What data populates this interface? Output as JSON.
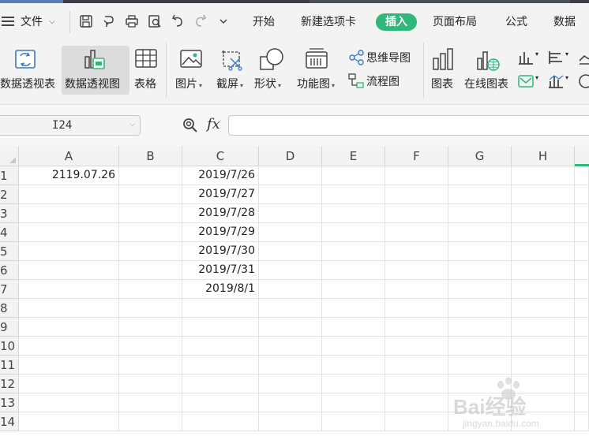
{
  "menubar": {
    "file_label": "文件",
    "tabs": [
      "开始",
      "新建选项卡",
      "插入",
      "页面布局",
      "公式",
      "数据"
    ],
    "active_tab": "插入",
    "accent": "#2fb87a"
  },
  "ribbon": {
    "pivot_table": "数据透视表",
    "pivot_chart": "数据透视图",
    "table": "表格",
    "picture": "图片",
    "screenshot": "截屏",
    "shapes": "形状",
    "function_chart": "功能图",
    "mind_map": "思维导图",
    "flowchart": "流程图",
    "chart": "图表",
    "online_chart": "在线图表"
  },
  "formula_bar": {
    "name_box": "I24",
    "fx": "fx",
    "formula": ""
  },
  "sheet": {
    "columns": [
      "A",
      "B",
      "C",
      "D",
      "E",
      "F",
      "G",
      "H"
    ],
    "rows": [
      "1",
      "2",
      "3",
      "4",
      "5",
      "6",
      "7",
      "8",
      "9",
      "10",
      "11",
      "12",
      "13",
      "14"
    ],
    "cells": {
      "A1": "2119.07.26",
      "C1": "2019/7/26",
      "C2": "2019/7/27",
      "C3": "2019/7/28",
      "C4": "2019/7/29",
      "C5": "2019/7/30",
      "C6": "2019/7/31",
      "C7": "2019/8/1"
    }
  },
  "watermark": {
    "brand": "Bai经验",
    "url": "jingyan.baidu.com"
  }
}
